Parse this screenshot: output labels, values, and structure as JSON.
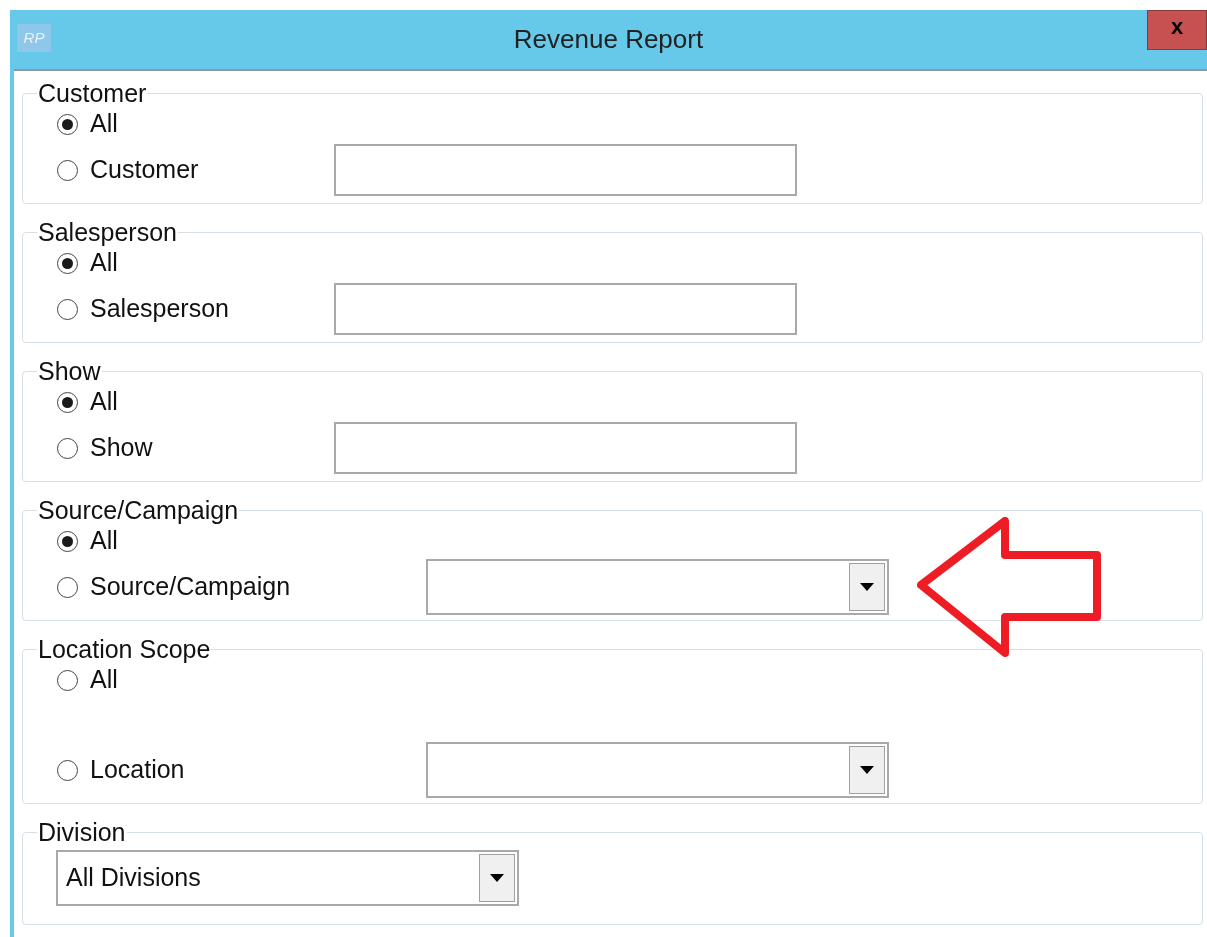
{
  "window": {
    "logo": "RP",
    "title": "Revenue Report",
    "close": "x"
  },
  "groups": [
    {
      "kind": "radio",
      "legend": "Customer",
      "options": [
        {
          "label": "All",
          "selected": true
        },
        {
          "label": "Customer",
          "selected": false,
          "field": {
            "kind": "text"
          }
        }
      ]
    },
    {
      "kind": "radio",
      "legend": "Salesperson",
      "options": [
        {
          "label": "All",
          "selected": true
        },
        {
          "label": "Salesperson",
          "selected": false,
          "field": {
            "kind": "text"
          }
        }
      ]
    },
    {
      "kind": "radio",
      "legend": "Show",
      "options": [
        {
          "label": "All",
          "selected": true
        },
        {
          "label": "Show",
          "selected": false,
          "field": {
            "kind": "text"
          }
        }
      ]
    },
    {
      "kind": "radio",
      "legend": "Source/Campaign",
      "options": [
        {
          "label": "All",
          "selected": true
        },
        {
          "label": "Source/Campaign",
          "selected": false,
          "field": {
            "kind": "combo"
          }
        }
      ]
    },
    {
      "kind": "radio-spaced",
      "legend": "Location Scope",
      "options": [
        {
          "label": "All",
          "selected": false
        },
        {
          "label": "Location",
          "selected": false,
          "field": {
            "kind": "combo"
          }
        }
      ]
    },
    {
      "kind": "combo",
      "legend": "Division",
      "value": "All Divisions"
    }
  ]
}
